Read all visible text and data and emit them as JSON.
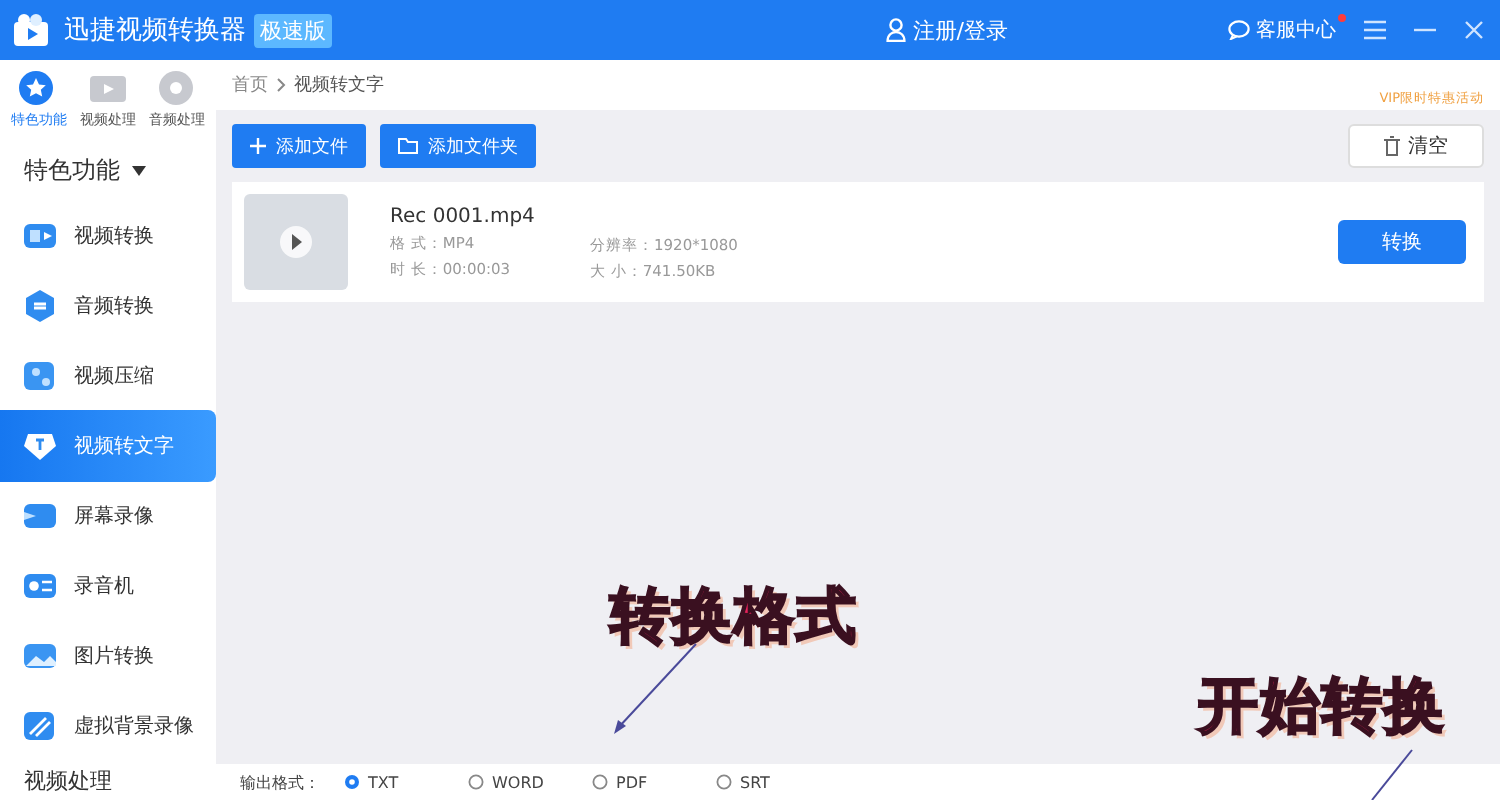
{
  "window": {
    "title": "迅捷视频转换器",
    "edition_badge": "极速版"
  },
  "header": {
    "login": "注册/登录",
    "support": "客服中心",
    "notification": true
  },
  "sidebar": {
    "tabs": [
      {
        "label": "特色功能",
        "selected": true
      },
      {
        "label": "视频处理",
        "selected": false
      },
      {
        "label": "音频处理",
        "selected": false
      }
    ],
    "section": "特色功能",
    "items": [
      {
        "label": "视频转换",
        "selected": false
      },
      {
        "label": "音频转换",
        "selected": false
      },
      {
        "label": "视频压缩",
        "selected": false
      },
      {
        "label": "视频转文字",
        "selected": true
      },
      {
        "label": "屏幕录像",
        "selected": false
      },
      {
        "label": "录音机",
        "selected": false
      },
      {
        "label": "图片转换",
        "selected": false
      },
      {
        "label": "虚拟背景录像",
        "selected": false
      }
    ],
    "next_section": "视频处理"
  },
  "breadcrumb": [
    "首页",
    "视频转文字"
  ],
  "promo": "VIP限时特惠活动",
  "toolbar": {
    "add_file": "添加文件",
    "add_folder": "添加文件夹",
    "clear": "清空"
  },
  "files": [
    {
      "name": "Rec 0001.mp4",
      "format_label": "格 式：",
      "format": "MP4",
      "duration_label": "时 长：",
      "duration": "00:00:03",
      "resolution_label": "分辨率：",
      "resolution": "1920*1080",
      "size_label": "大 小：",
      "size": "741.50KB",
      "action": "转换"
    }
  ],
  "output": {
    "label": "输出格式：",
    "options": [
      {
        "label": "TXT",
        "selected": true
      },
      {
        "label": "WORD",
        "selected": false
      },
      {
        "label": "PDF",
        "selected": false
      },
      {
        "label": "SRT",
        "selected": false
      }
    ]
  },
  "annotations": [
    {
      "text": "转换格式"
    },
    {
      "text": "开始转换"
    }
  ]
}
